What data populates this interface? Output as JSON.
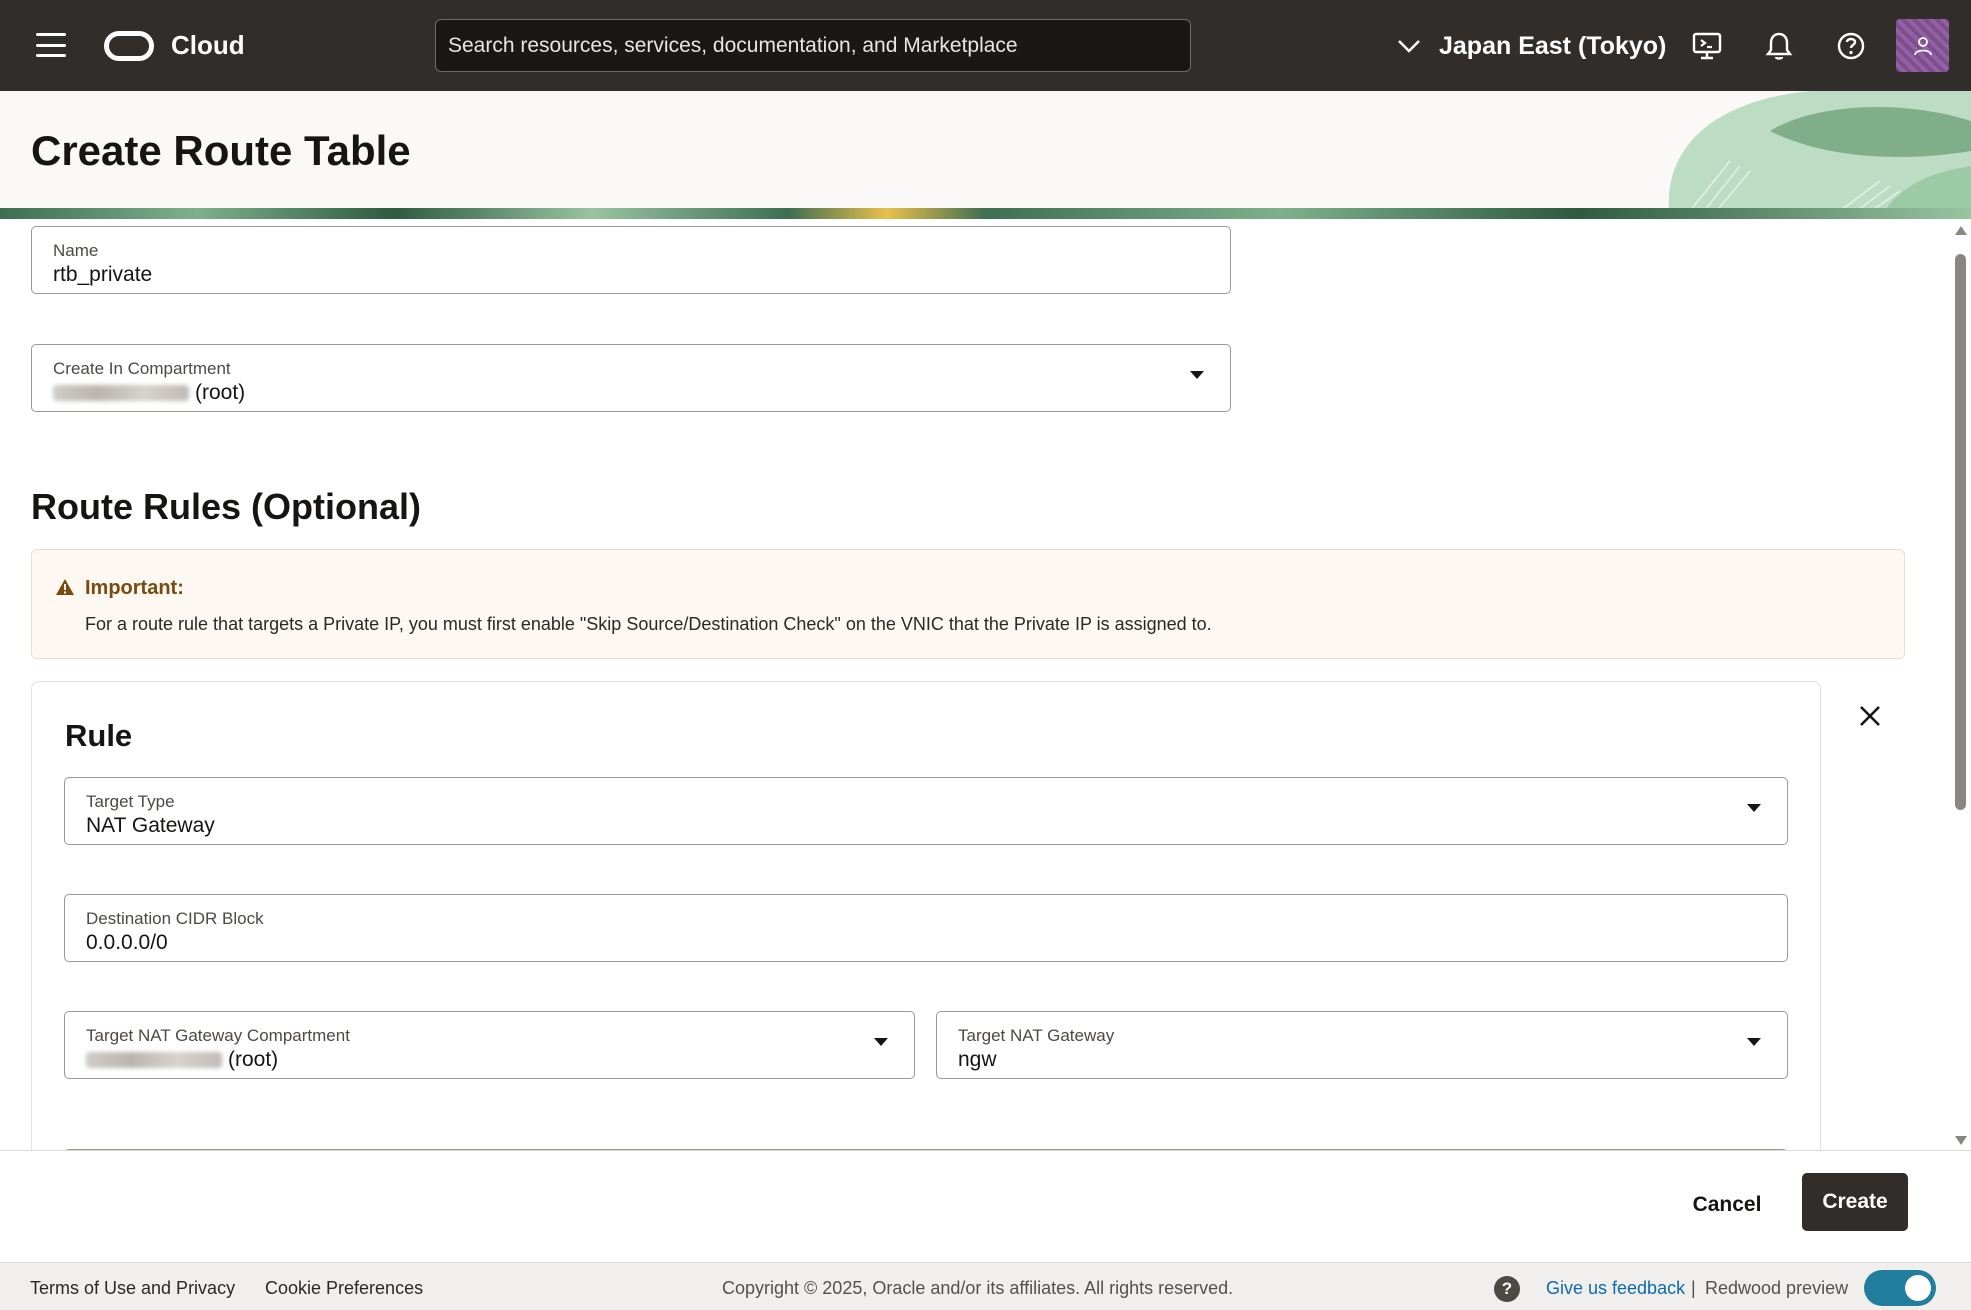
{
  "topbar": {
    "brand": "Cloud",
    "search_placeholder": "Search resources, services, documentation, and Marketplace",
    "region": "Japan East (Tokyo)"
  },
  "page": {
    "title": "Create Route Table"
  },
  "form": {
    "name": {
      "label": "Name",
      "value": "rtb_private"
    },
    "compartment": {
      "label": "Create In Compartment",
      "value_suffix": "(root)"
    }
  },
  "route_rules": {
    "title": "Route Rules (Optional)",
    "alert": {
      "heading": "Important:",
      "message": "For a route rule that targets a Private IP, you must first enable \"Skip Source/Destination Check\" on the VNIC that the Private IP is assigned to."
    },
    "rule": {
      "title": "Rule",
      "target_type": {
        "label": "Target Type",
        "value": "NAT Gateway"
      },
      "destination_cidr": {
        "label": "Destination CIDR Block",
        "value": "0.0.0.0/0"
      },
      "target_compartment": {
        "label": "Target NAT Gateway Compartment",
        "value_suffix": "(root)"
      },
      "target_gateway": {
        "label": "Target NAT Gateway",
        "value": "ngw"
      }
    }
  },
  "actions": {
    "cancel": "Cancel",
    "create": "Create"
  },
  "footer": {
    "terms": "Terms of Use and Privacy",
    "cookies": "Cookie Preferences",
    "copyright": "Copyright © 2025, Oracle and/or its affiliates. All rights reserved.",
    "help": "?",
    "feedback": "Give us feedback",
    "separator": "|",
    "redwood": "Redwood preview",
    "redwood_enabled": true
  },
  "colors": {
    "topbar": "#312d2a",
    "primary_button": "#312d2a",
    "link": "#0b6ba8",
    "toggle_on": "#227e9e",
    "alert_text": "#7a4a0e"
  }
}
